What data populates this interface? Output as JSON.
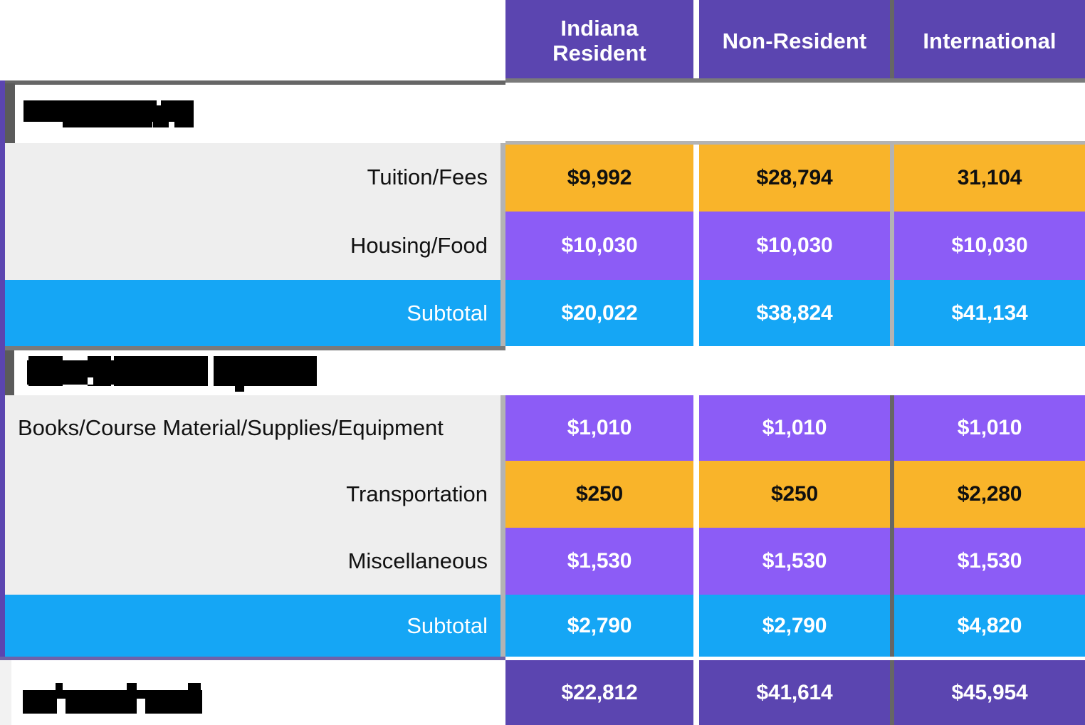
{
  "table": {
    "columns": [
      {
        "id": "indiana",
        "label": "Indiana\nResident",
        "line1": "Indiana",
        "line2": "Resident"
      },
      {
        "id": "nonresident",
        "label": "Non-Resident",
        "line1": "Non-Resident",
        "line2": ""
      },
      {
        "id": "international",
        "label": "International",
        "line1": "International",
        "line2": ""
      }
    ],
    "sections": [
      {
        "id": "section-1",
        "title": "",
        "title_redacted": true,
        "rows": [
          {
            "label": "Tuition/Fees",
            "style": "orange",
            "values": [
              "$9,992",
              "$28,794",
              "31,104"
            ]
          },
          {
            "label": "Housing/Food",
            "style": "purple",
            "values": [
              "$10,030",
              "$10,030",
              "$10,030"
            ]
          },
          {
            "label": "Subtotal",
            "style": "blue",
            "values": [
              "$20,022",
              "$38,824",
              "$41,134"
            ]
          }
        ]
      },
      {
        "id": "section-2",
        "title": "",
        "title_redacted": true,
        "rows": [
          {
            "label": "Books/Course Material/Supplies/Equipment",
            "style": "purple",
            "values": [
              "$1,010",
              "$1,010",
              "$1,010"
            ]
          },
          {
            "label": "Transportation",
            "style": "orange",
            "values": [
              "$250",
              "$250",
              "$2,280"
            ]
          },
          {
            "label": "Miscellaneous",
            "style": "purple",
            "values": [
              "$1,530",
              "$1,530",
              "$1,530"
            ]
          },
          {
            "label": "Subtotal",
            "style": "blue",
            "values": [
              "$2,790",
              "$2,790",
              "$4,820"
            ]
          }
        ]
      }
    ],
    "total_row": {
      "label": "",
      "label_redacted": true,
      "style": "dark",
      "values": [
        "$22,812",
        "$41,614",
        "$45,954"
      ]
    }
  },
  "colors": {
    "header_purple": "#5b45b0",
    "value_orange": "#f9b42a",
    "value_purple": "#8c5cf6",
    "value_blue": "#15a6f5",
    "label_grey": "#eeeeee",
    "gutter_grey": "#b3b3b3",
    "border_grey": "#666666",
    "redaction": "#000000"
  },
  "chart_data": {
    "type": "table",
    "title": "",
    "categories": [
      "Indiana Resident",
      "Non-Resident",
      "International"
    ],
    "series": [
      {
        "name": "Tuition/Fees",
        "values": [
          9992,
          28794,
          31104
        ]
      },
      {
        "name": "Housing/Food",
        "values": [
          10030,
          10030,
          10030
        ]
      },
      {
        "name": "Subtotal (Direct)",
        "values": [
          20022,
          38824,
          41134
        ]
      },
      {
        "name": "Books/Course Material/Supplies/Equipment",
        "values": [
          1010,
          1010,
          1010
        ]
      },
      {
        "name": "Transportation",
        "values": [
          250,
          250,
          2280
        ]
      },
      {
        "name": "Miscellaneous",
        "values": [
          1530,
          1530,
          1530
        ]
      },
      {
        "name": "Subtotal (Indirect)",
        "values": [
          2790,
          2790,
          4820
        ]
      },
      {
        "name": "Total",
        "values": [
          22812,
          41614,
          45954
        ]
      }
    ],
    "xlabel": "",
    "ylabel": ""
  }
}
